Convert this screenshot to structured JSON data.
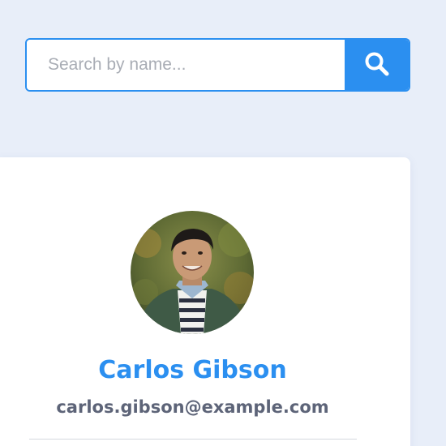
{
  "search": {
    "placeholder": "Search by name...",
    "value": "",
    "button_icon": "search-icon"
  },
  "profile": {
    "name": "Carlos Gibson",
    "email": "carlos.gibson@example.com",
    "avatar_icon": "avatar-photo"
  },
  "colors": {
    "accent": "#2b8ff0",
    "background": "#e8eef9",
    "card": "#ffffff",
    "email_text": "#5d6478"
  }
}
